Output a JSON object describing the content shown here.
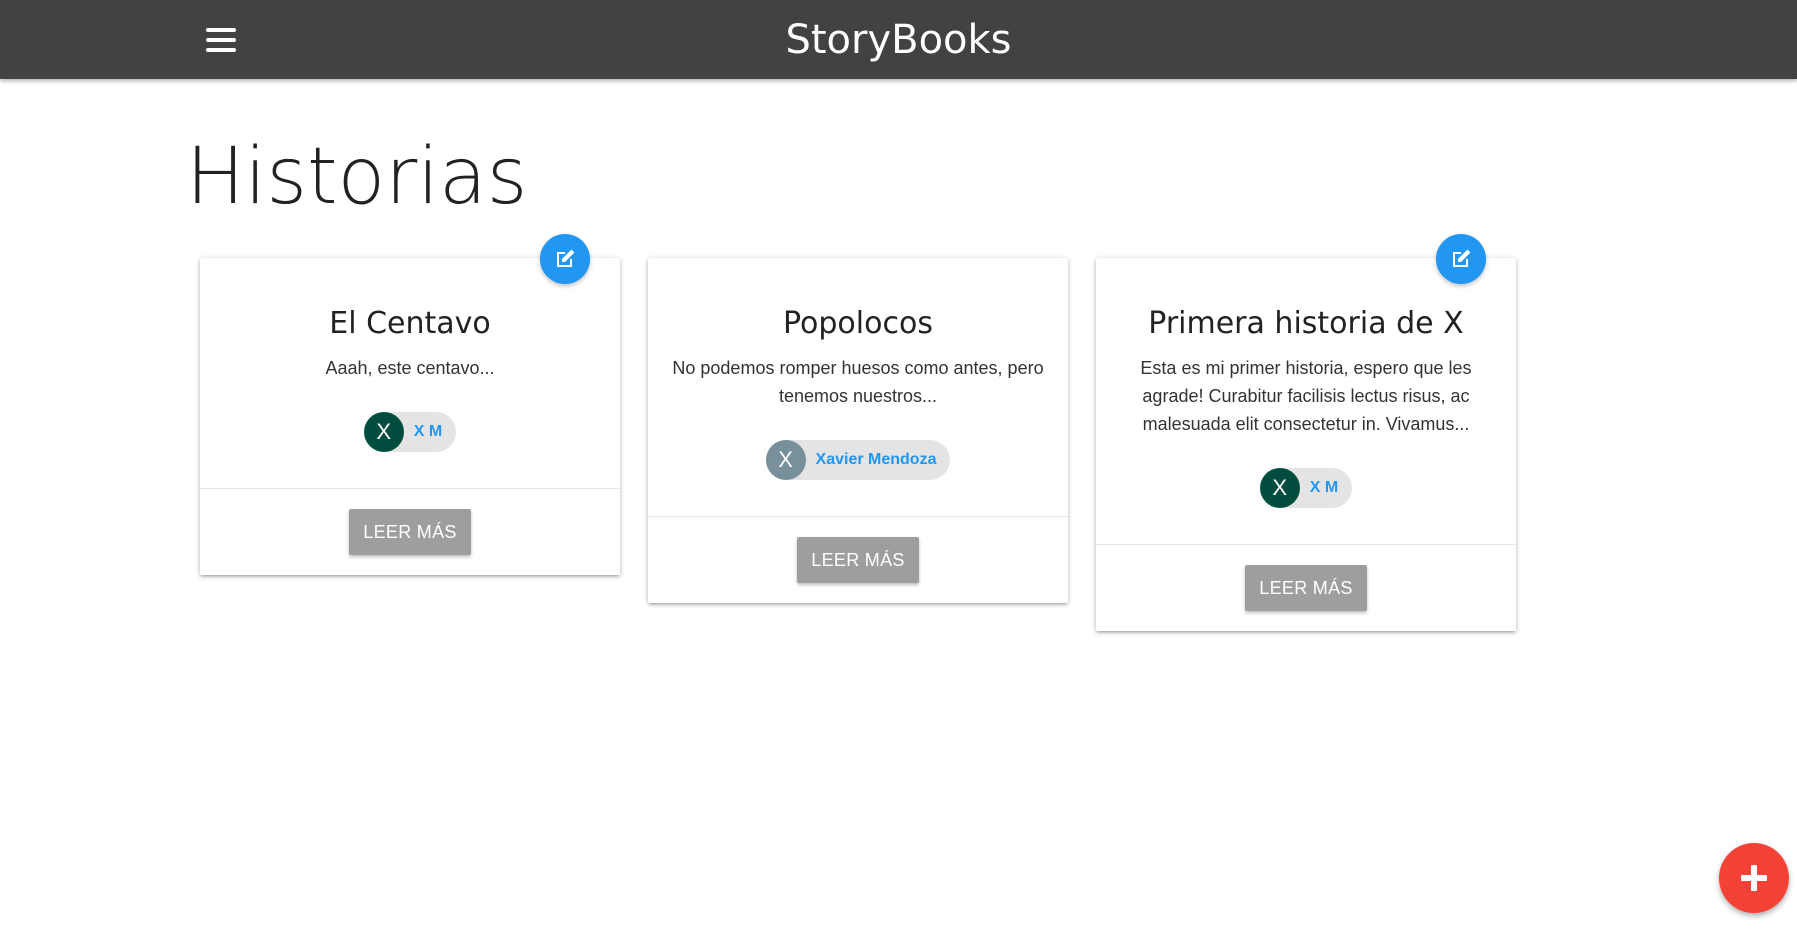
{
  "app": {
    "brand": "StoryBooks"
  },
  "page": {
    "title": "Historias"
  },
  "colors": {
    "navbar": "#424242",
    "accent_blue": "#2196f3",
    "fab_red": "#f44336",
    "button_grey": "#9e9e9e"
  },
  "stories": [
    {
      "title": "El Centavo",
      "description": "Aaah, este centavo...",
      "author_initial": "X",
      "author_name": "X M",
      "avatar_color": "#004d40",
      "editable": true,
      "button_label": "LEER MÁS"
    },
    {
      "title": "Popolocos",
      "description": "No podemos romper huesos como antes, pero tenemos nuestros...",
      "author_initial": "X",
      "author_name": "Xavier Mendoza",
      "avatar_color": "#78909c",
      "editable": false,
      "button_label": "LEER MÁS"
    },
    {
      "title": "Primera historia de X",
      "description": "Esta es mi primer historia, espero que les agrade! Curabitur facilisis lectus risus, ac malesuada elit consectetur in. Vivamus...",
      "author_initial": "X",
      "author_name": "X M",
      "avatar_color": "#004d40",
      "editable": true,
      "button_label": "LEER MÁS"
    }
  ],
  "icons": {
    "menu": "hamburger-menu-icon",
    "edit": "edit-icon",
    "add": "plus-icon"
  }
}
